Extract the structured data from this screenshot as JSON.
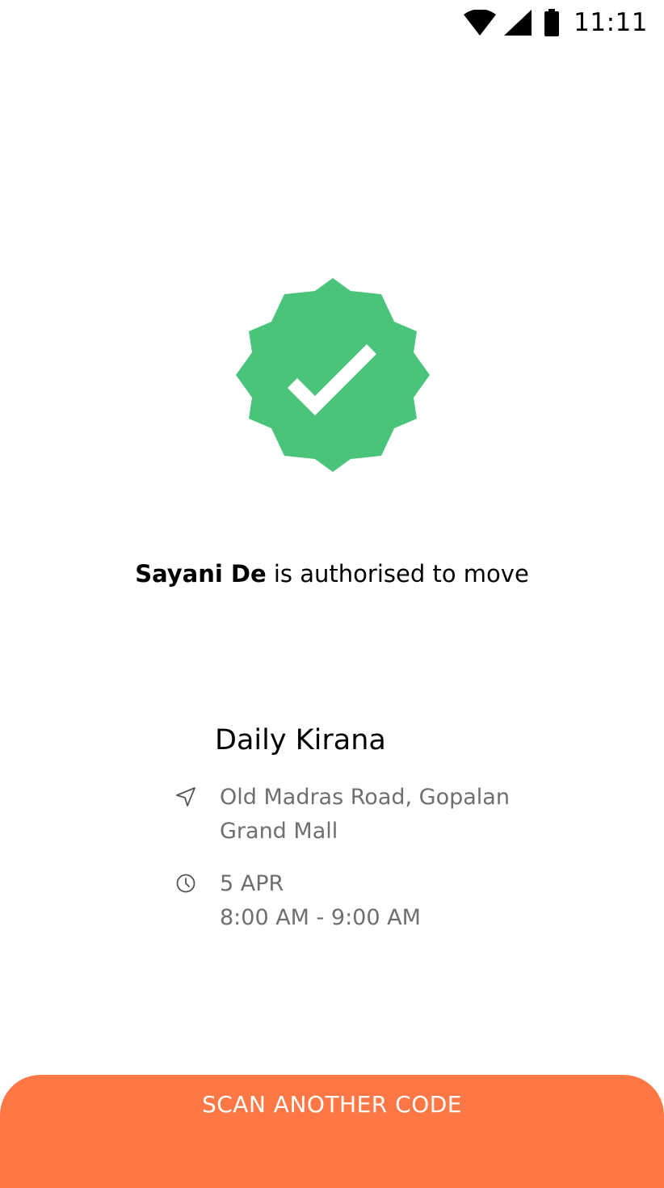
{
  "status_bar": {
    "time": "11:11",
    "icons": [
      "wifi-icon",
      "signal-icon",
      "battery-icon"
    ]
  },
  "badge": {
    "icon": "verified-badge-icon",
    "color": "#4bc47b"
  },
  "authorisation": {
    "person": "Sayani De",
    "message": " is authorised to move"
  },
  "store": {
    "name": "Daily Kirana",
    "address_line1": "Old Madras Road, Gopalan",
    "address_line2": "Grand Mall",
    "address_icon": "navigation-arrow-icon",
    "date": "5 APR",
    "time_window": "8:00 AM - 9:00 AM",
    "time_icon": "clock-icon"
  },
  "action": {
    "scan_label": "SCAN ANOTHER CODE",
    "color": "#ff7744"
  }
}
